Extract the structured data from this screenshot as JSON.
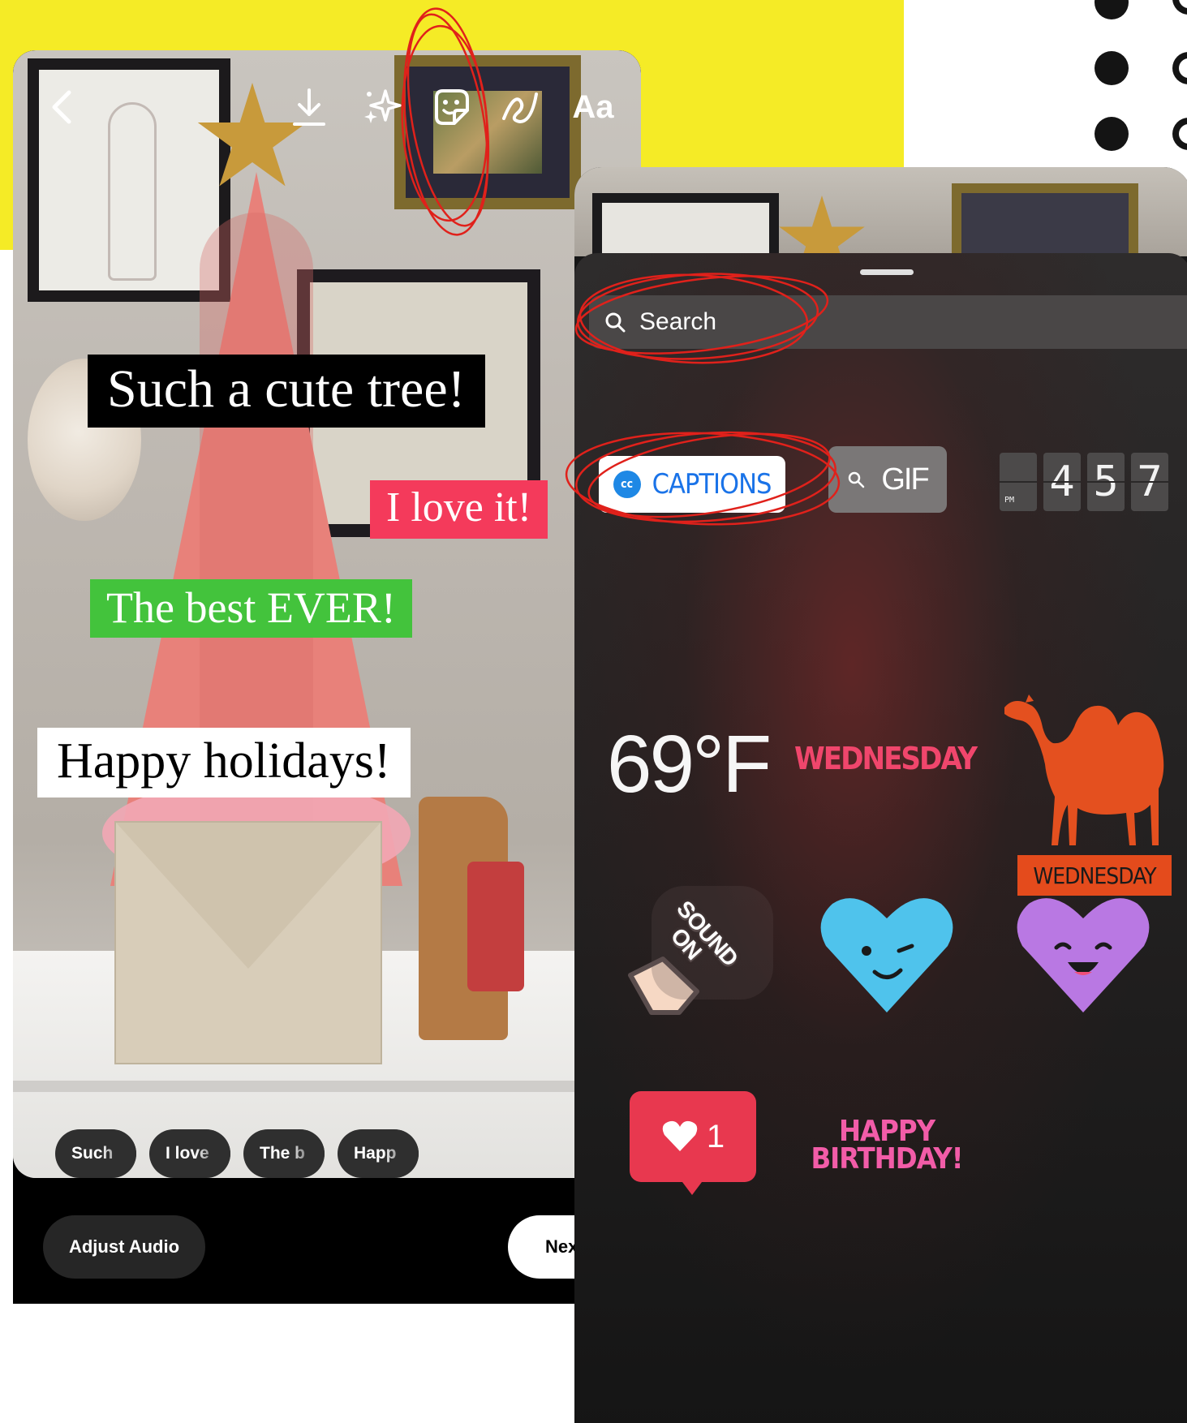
{
  "story_editor": {
    "toolbar": {
      "back_icon": "chevron-left-icon",
      "download_icon": "download-icon",
      "effects_icon": "sparkles-icon",
      "sticker_icon": "sticker-icon",
      "draw_icon": "scribble-icon",
      "text_label": "Aa"
    },
    "captions": [
      "Such a cute tree!",
      "I love it!",
      "The best EVER!",
      "Happy holidays!"
    ],
    "caption_colors": [
      "#000000",
      "#f43a5b",
      "#43c33c",
      "#ffffff"
    ],
    "caption_chips": [
      "Such",
      "I love",
      "The b",
      "Happ"
    ],
    "adjust_audio_label": "Adjust Audio",
    "next_label": "Next"
  },
  "sticker_tray": {
    "search_placeholder": "Search",
    "captions_label": "CAPTIONS",
    "captions_badge": "cc",
    "gif_label": "GIF",
    "clock": {
      "period": "PM",
      "digits": [
        "4",
        "5",
        "7"
      ]
    },
    "temperature": "69°F",
    "weekday_gradient": "WEDNESDAY",
    "weekday_camel": "WEDNESDAY",
    "sound_on_line1": "SOUND",
    "sound_on_line2": "ON",
    "like_count": "1",
    "birthday_line1": "HAPPY",
    "birthday_line2": "BIRTHDAY!"
  },
  "colors": {
    "yellow_accent": "#f5eb26",
    "annotation_red": "#e0211b"
  }
}
